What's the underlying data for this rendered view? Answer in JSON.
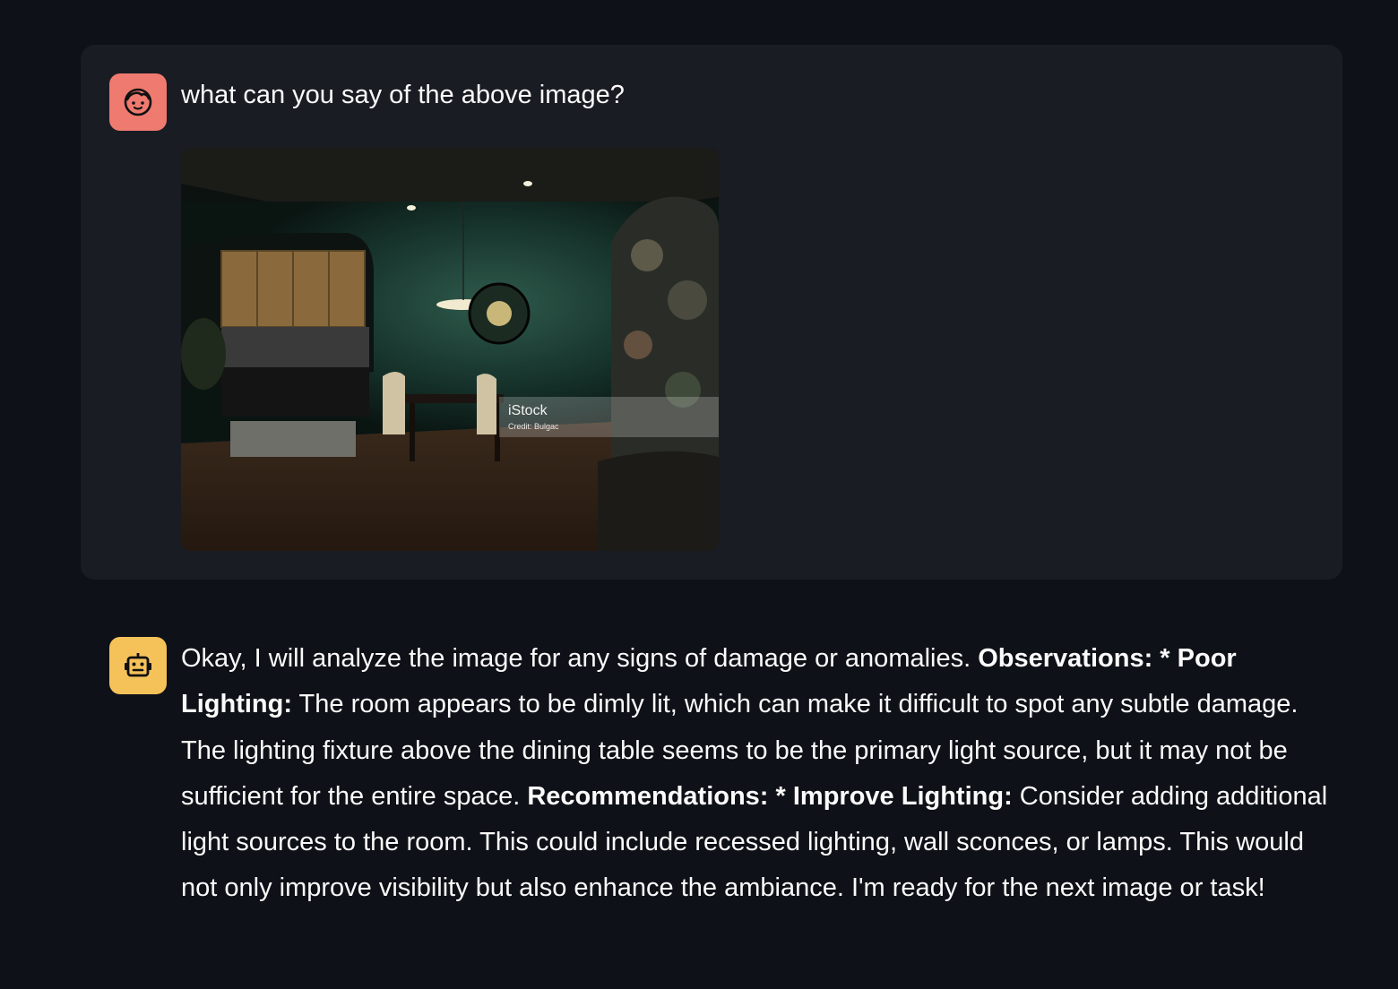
{
  "user_message": {
    "text": "what can you say of the above image?",
    "avatar_icon": "user-face-icon",
    "avatar_color": "#ef7a6f",
    "image": {
      "watermark_brand": "iStock",
      "watermark_credit": "Credit: Bulgac"
    }
  },
  "assistant_message": {
    "avatar_icon": "robot-icon",
    "avatar_color": "#f5c25a",
    "intro": "Okay, I will analyze the image for any signs of damage or anomalies. ",
    "observations_heading": "Observations: * Poor Lighting:",
    "observations_text": " The room appears to be dimly lit, which can make it difficult to spot any subtle damage. The lighting fixture above the dining table seems to be the primary light source, but it may not be sufficient for the entire space. ",
    "recommendations_heading": "Recommendations: * Improve Lighting:",
    "recommendations_text": " Consider adding additional light sources to the room. This could include recessed lighting, wall sconces, or lamps. This would not only improve visibility but also enhance the ambiance. I'm ready for the next image or task!"
  },
  "colors": {
    "background": "#0e1117",
    "user_bubble": "#1a1c24",
    "text": "#fafafa"
  }
}
